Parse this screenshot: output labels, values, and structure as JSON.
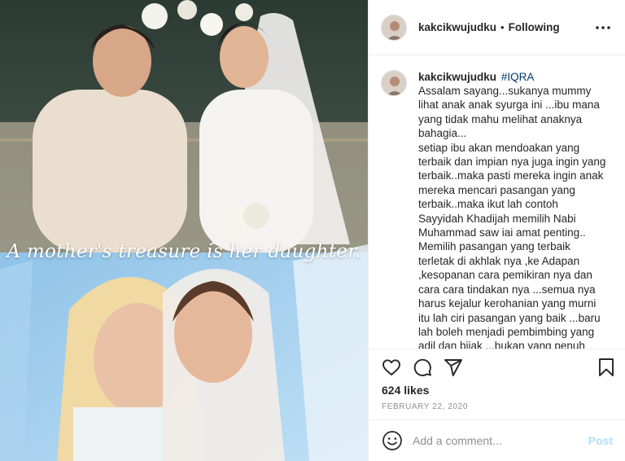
{
  "photo": {
    "overlay_text": "A mother's treasure is her daughter."
  },
  "header": {
    "username": "kakcikwujudku",
    "separator": "•",
    "follow_status": "Following",
    "more_icon": "more-horizontal-icon"
  },
  "caption": {
    "username": "kakcikwujudku",
    "hashtag": "#IQRA",
    "lines": [
      "Assalam sayang...sukanya mummy",
      "lihat anak anak syurga ini ...ibu mana",
      "yang tidak mahu melihat anaknya",
      "bahagia...",
      "setiap ibu akan mendoakan yang",
      "terbaik dan impian nya juga ingin yang",
      "terbaik..maka pasti mereka ingin anak",
      "mereka mencari pasangan yang",
      "terbaik..maka ikut lah contoh",
      "Sayyidah Khadijah memilih Nabi",
      "Muhammad saw iai amat penting..",
      "Memilih pasangan yang terbaik",
      "terletak di akhlak nya ,ke Adapan",
      ",kesopanan cara pemikiran nya dan",
      "cara cara tindakan nya ...semua nya",
      "harus kejalur kerohanian yang murni",
      "itu lah ciri pasangan yang baik ...baru",
      "lah boleh menjadi pembimbing yang",
      "adil dan bijak ...bukan yang penuh"
    ]
  },
  "actions": {
    "icons": [
      "heart-icon",
      "comment-icon",
      "share-icon",
      "bookmark-icon"
    ],
    "likes": "624 likes",
    "date": "FEBRUARY 22, 2020"
  },
  "comment": {
    "placeholder": "Add a comment...",
    "post_label": "Post",
    "emoji_icon": "emoji-icon"
  },
  "colors": {
    "hashtag": "#00376b",
    "post_disabled": "#b2dffc",
    "muted": "#8e8e8e",
    "divider": "#efefef"
  }
}
